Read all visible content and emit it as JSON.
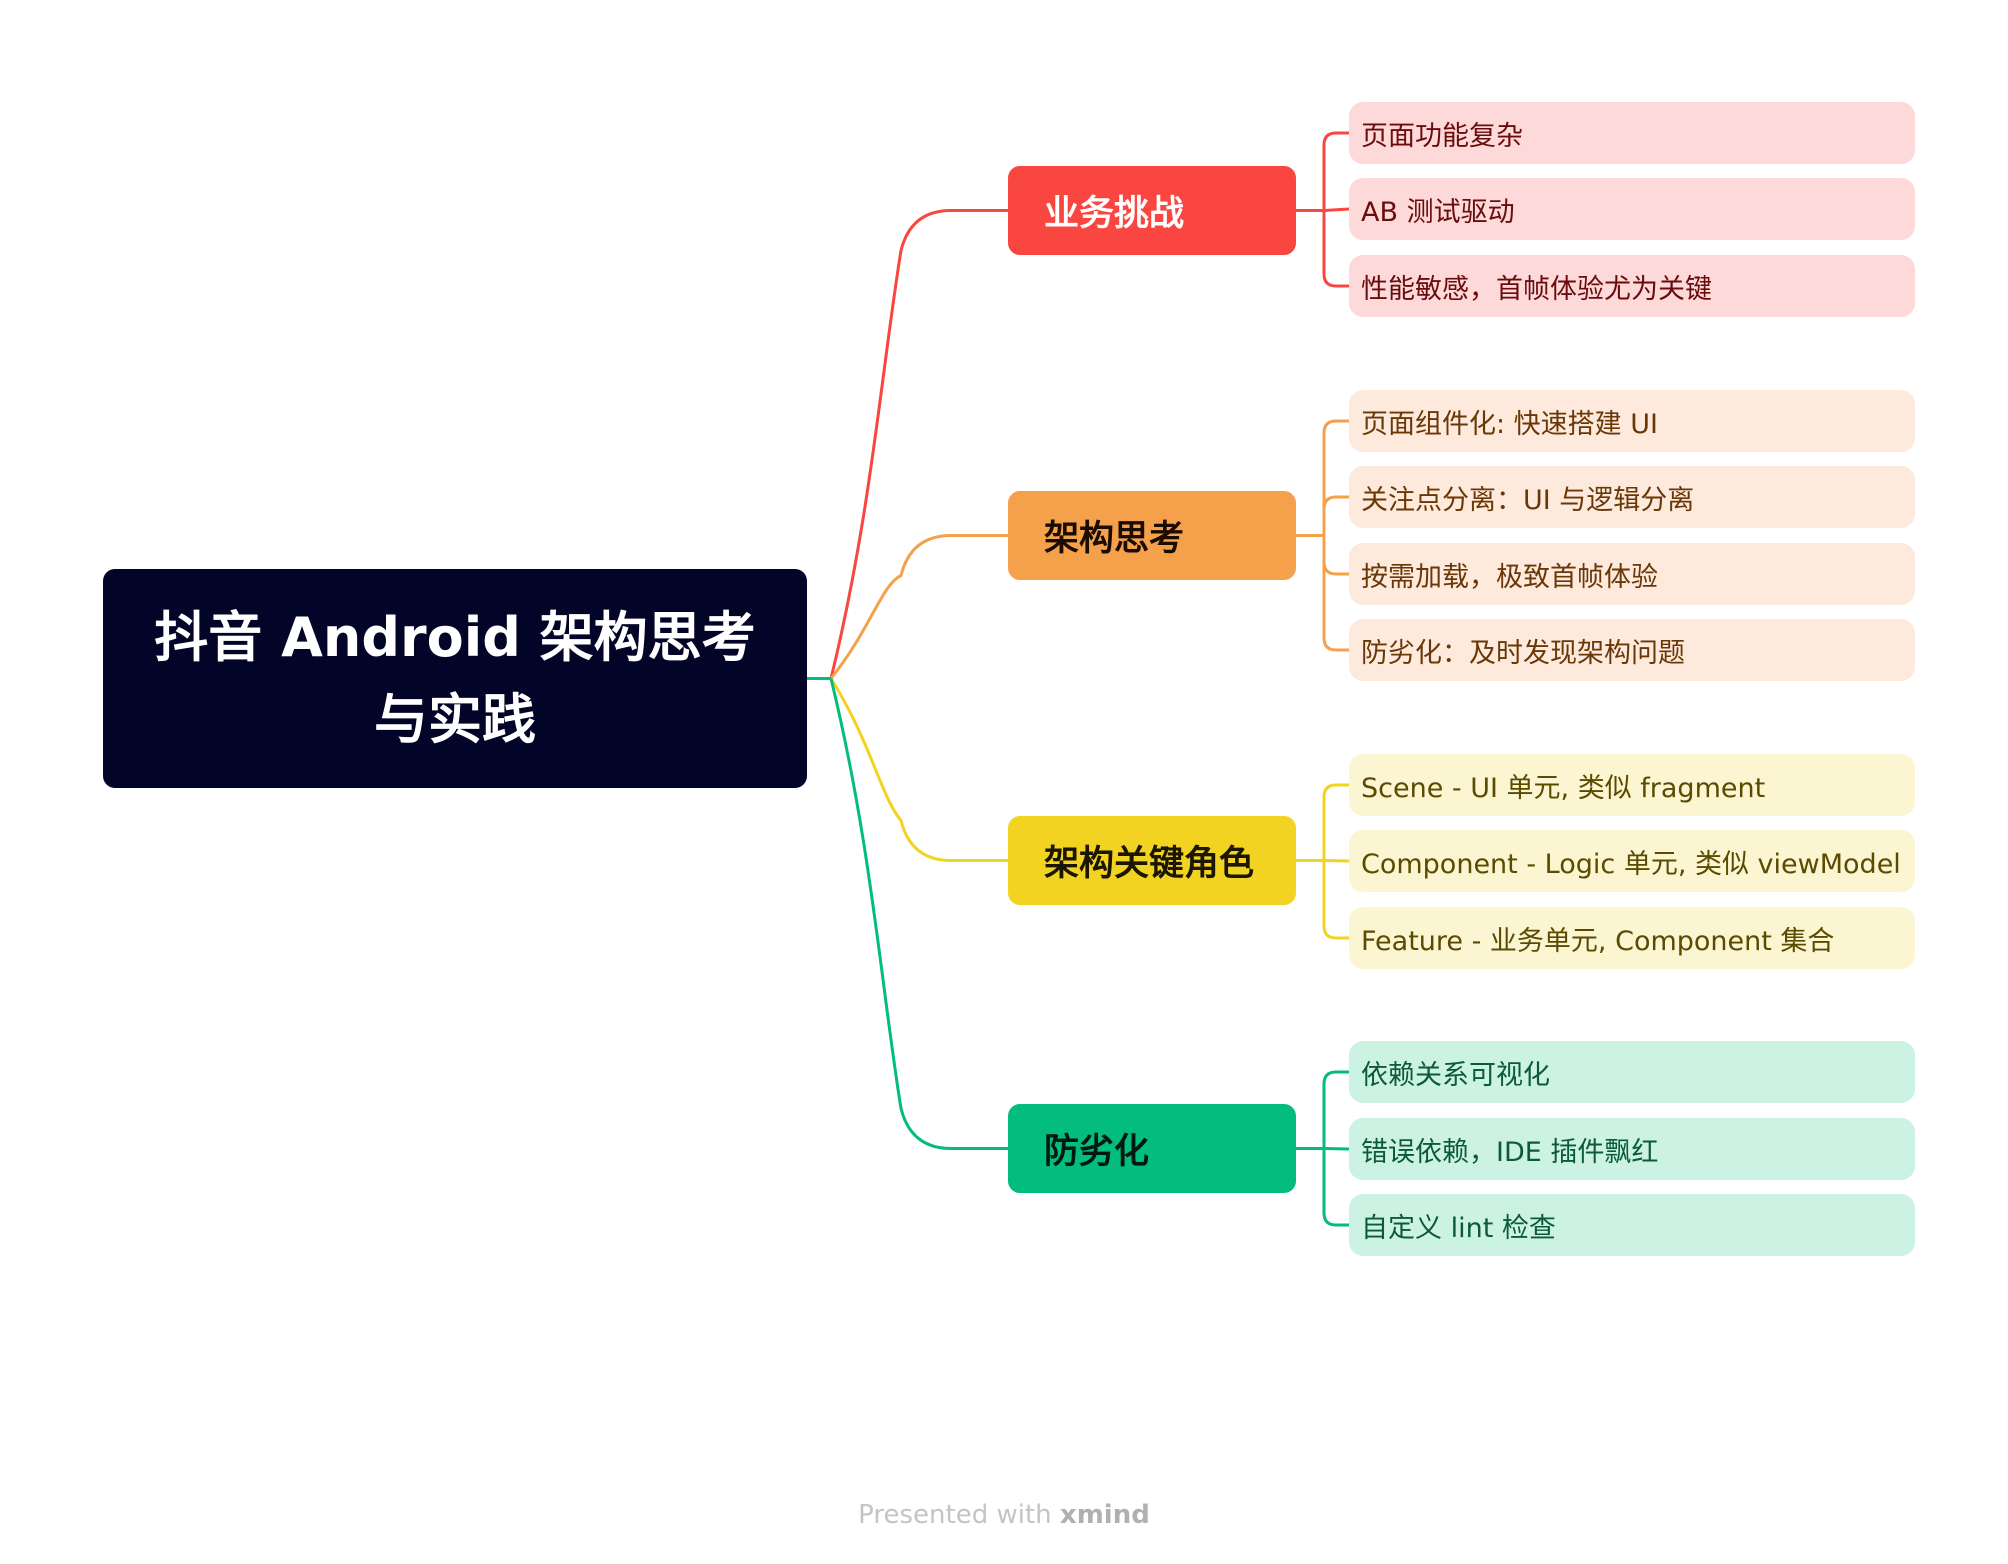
{
  "root": {
    "title": "抖音 Android 架构思考与实践",
    "line1": "抖音 Android 架构思考",
    "line2": "与实践",
    "color": "#020428"
  },
  "branches": [
    {
      "label": "业务挑战",
      "color": "#F94640",
      "text_color": "#ffffff",
      "leaf_bg": "#FDD9D9",
      "leaf_text": "#6B0C0C",
      "leaves": [
        "页面功能复杂",
        "AB 测试驱动",
        "性能敏感，首帧体验尤为关键"
      ]
    },
    {
      "label": "架构思考",
      "color": "#F5A04B",
      "text_color": "#1a0d00",
      "leaf_bg": "#FDEADC",
      "leaf_text": "#6A3706",
      "leaves": [
        "页面组件化: 快速搭建 UI",
        "关注点分离：UI 与逻辑分离",
        "按需加载，极致首帧体验",
        "防劣化：及时发现架构问题"
      ]
    },
    {
      "label": "架构关键角色",
      "color": "#F3D321",
      "text_color": "#1a1600",
      "leaf_bg": "#FBF5D2",
      "leaf_text": "#5A4B00",
      "leaves": [
        "Scene - UI 单元, 类似 fragment",
        "Component - Logic 单元, 类似 viewModel",
        "Feature - 业务单元, Component 集合"
      ]
    },
    {
      "label": "防劣化",
      "color": "#02BD7D",
      "text_color": "#001a10",
      "leaf_bg": "#CCF2E3",
      "leaf_text": "#0B5A3B",
      "leaves": [
        "依赖关系可视化",
        "错误依赖，IDE 插件飘红",
        "自定义 lint 检查"
      ]
    }
  ],
  "footer": {
    "prefix": "Presented with ",
    "brand": "xmind"
  }
}
